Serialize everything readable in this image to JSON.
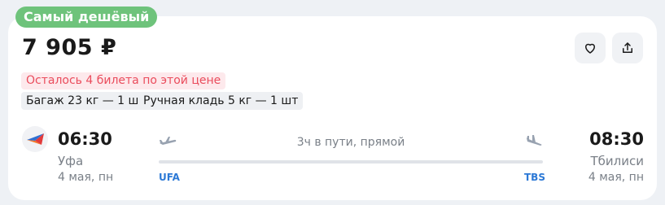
{
  "badge": {
    "label": "Самый дешёвый"
  },
  "price": {
    "value": "7 905 ₽"
  },
  "actions": {
    "favorite_icon": "heart-icon",
    "share_icon": "share-icon"
  },
  "alert": {
    "text": "Осталось 4 билета по этой цене"
  },
  "baggage": {
    "checked": "Багаж 23 кг — 1 шт",
    "carry_on": "Ручная кладь 5 кг — 1 шт"
  },
  "flight": {
    "airline_logo": "airline-logo",
    "departure": {
      "time": "06:30",
      "city": "Уфа",
      "date": "4 мая, пн",
      "iata": "UFA"
    },
    "arrival": {
      "time": "08:30",
      "city": "Тбилиси",
      "date": "4 мая, пн",
      "iata": "TBS"
    },
    "duration": "3ч в пути, прямой"
  },
  "colors": {
    "badge": "#6ec37b",
    "alert_text": "#ea4c5c",
    "alert_bg": "#fde9ec",
    "iata": "#2c79d6"
  }
}
